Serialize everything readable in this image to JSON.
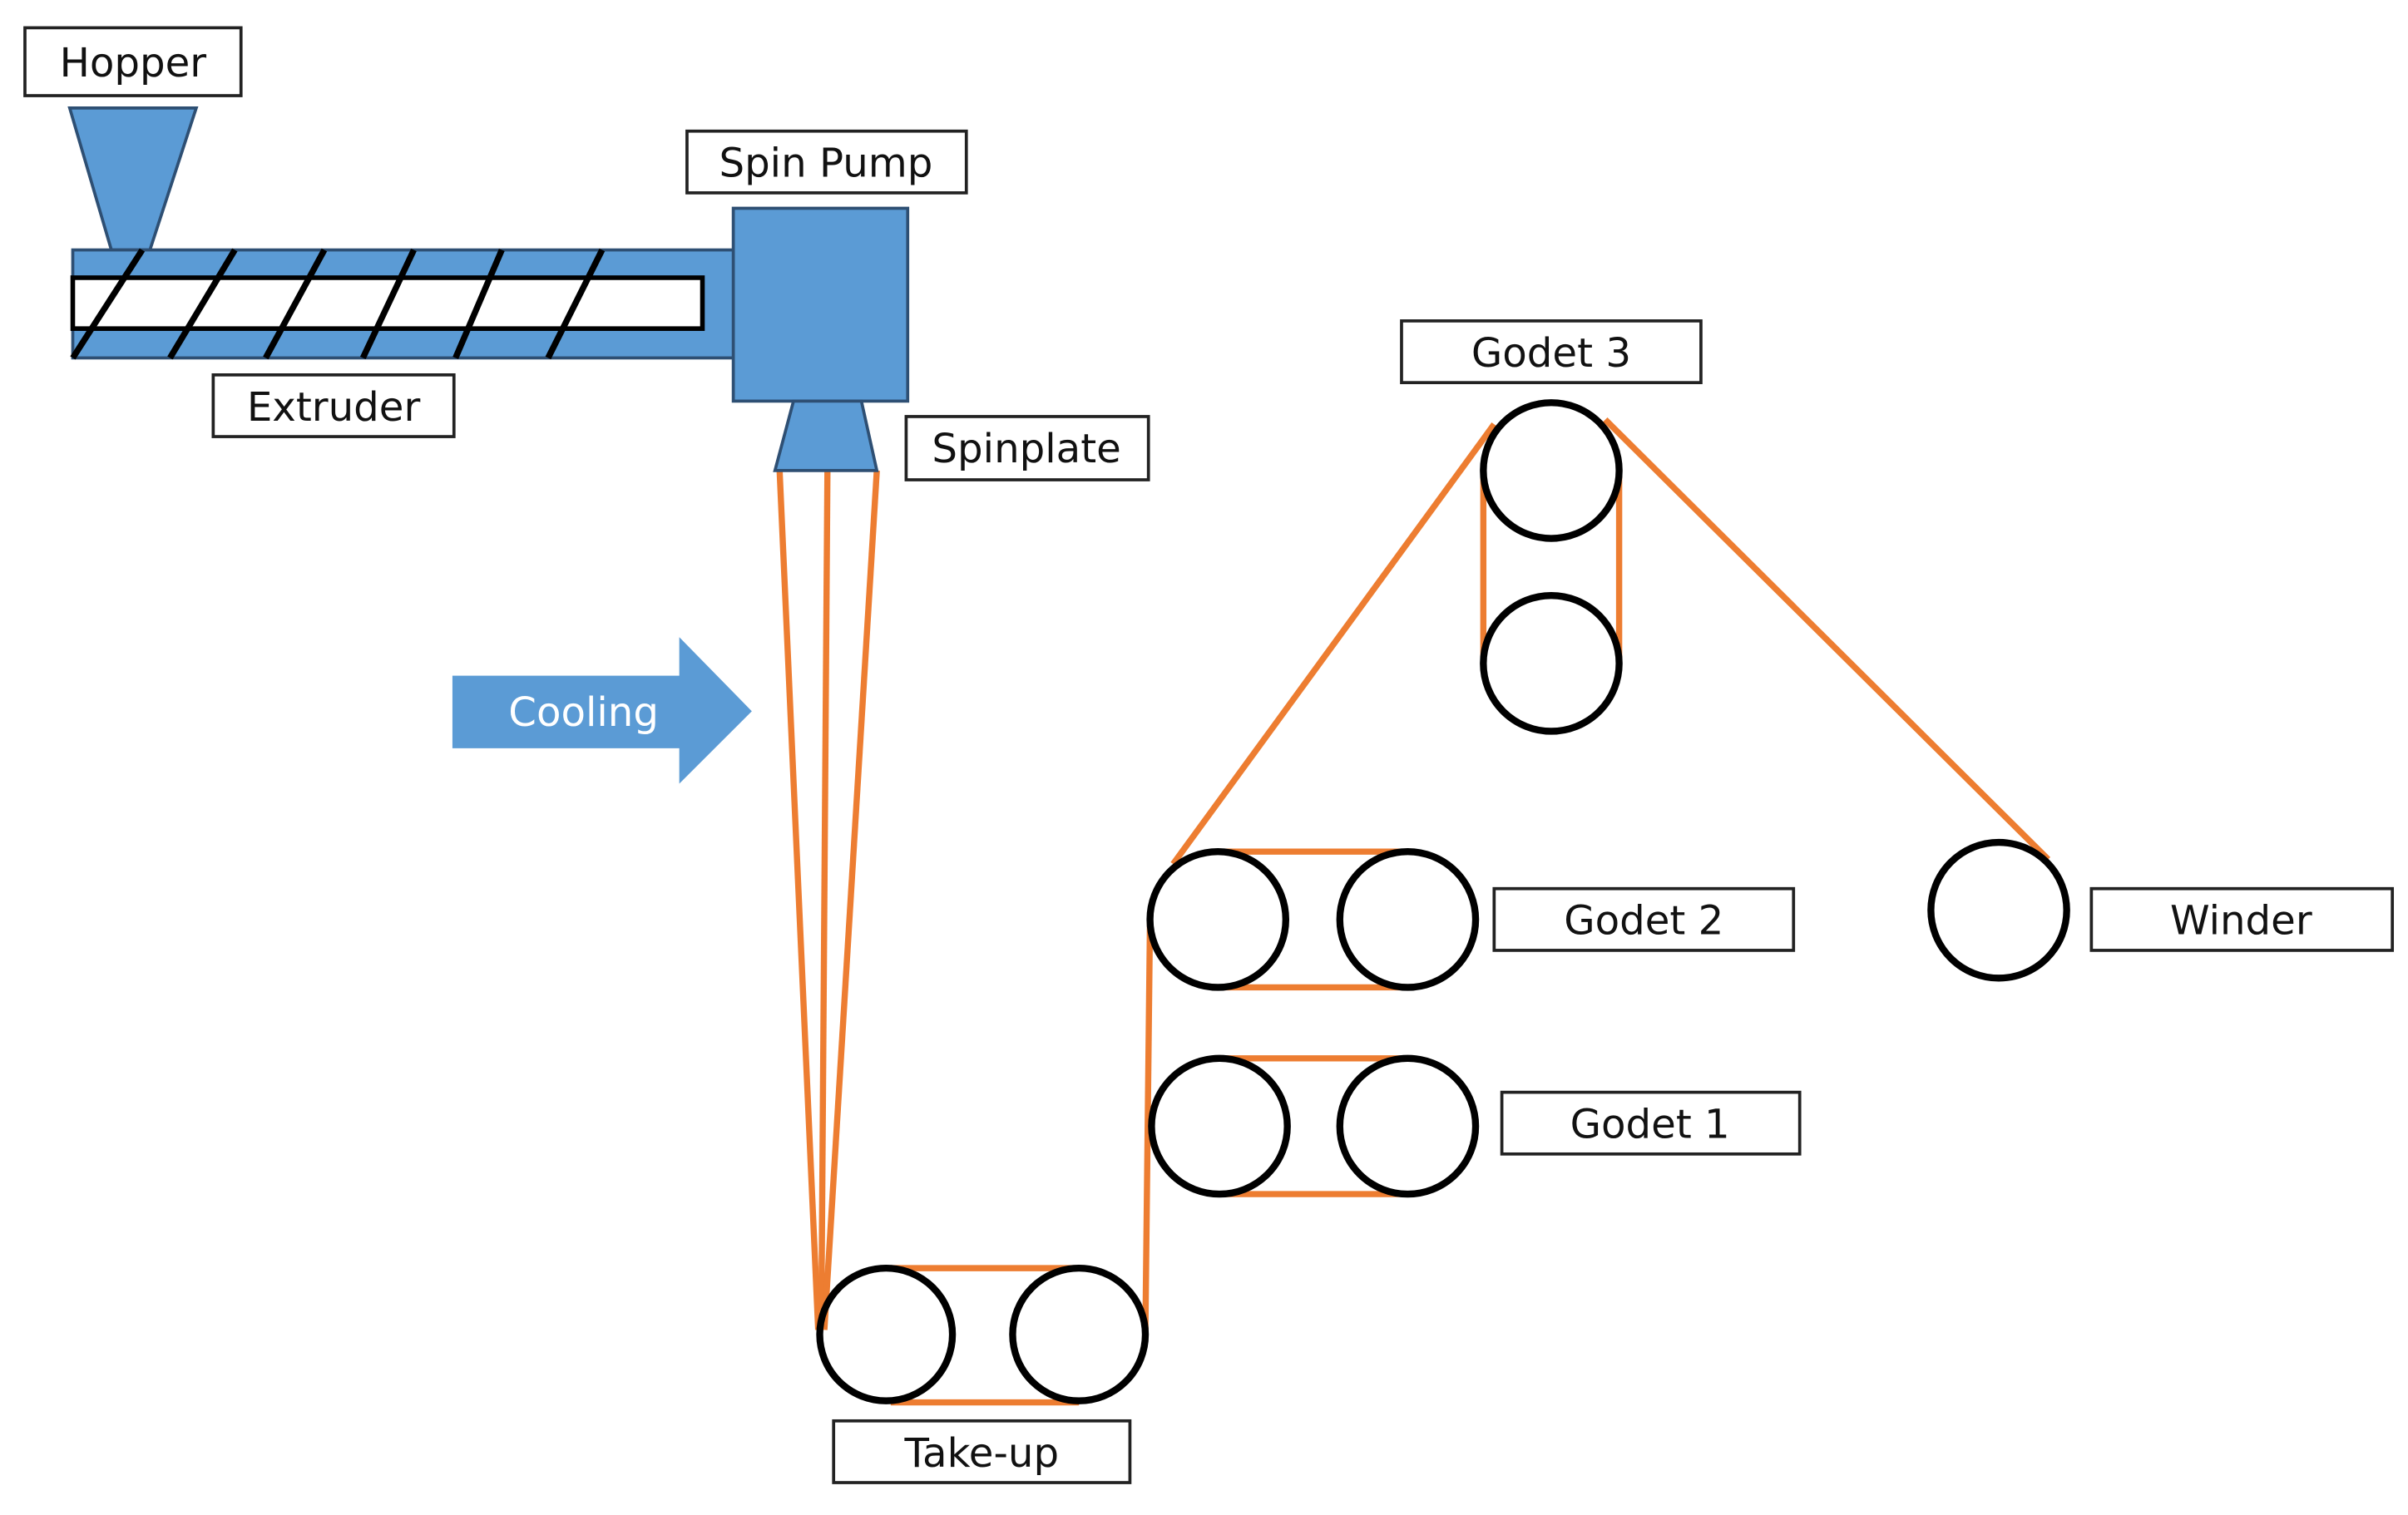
{
  "labels": {
    "hopper": "Hopper",
    "spin_pump": "Spin Pump",
    "extruder": "Extruder",
    "spinplate": "Spinplate",
    "cooling": "Cooling",
    "godet3": "Godet 3",
    "godet2": "Godet 2",
    "godet1": "Godet 1",
    "winder": "Winder",
    "take_up": "Take-up"
  },
  "colors": {
    "equipment": "#5b9bd5",
    "fiber": "#ed7d31",
    "rollers": "#000000"
  }
}
